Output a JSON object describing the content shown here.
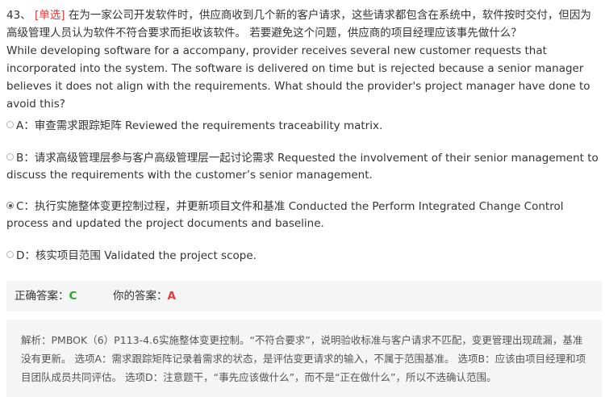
{
  "question": {
    "number": "43、",
    "tag": "[单选]",
    "text_cn": "在为一家公司开发软件时，供应商收到几个新的客户请求，这些请求都包含在系统中，软件按时交付，但因为高级管理人员认为软件不符合要求而拒收该软件。 若要避免这个问题，供应商的项目经理应该事先做什么？",
    "text_en": "While developing software for a accompany, provider receives several new customer requests that incorporated into the system. The software is delivered on time but is rejected because a senior manager believes it does not align with the requirements. What should the provider's project manager have done to avoid this?"
  },
  "options": [
    {
      "key": "A：",
      "text": "审查需求跟踪矩阵 Reviewed the requirements traceability matrix.",
      "selected": false
    },
    {
      "key": "B：",
      "text": "请求高级管理层参与客户高级管理层一起讨论需求 Requested the involvement of their senior management to discuss the requirements with the customer’s senior management.",
      "selected": false
    },
    {
      "key": "C：",
      "text": "执行实施整体变更控制过程，并更新项目文件和基准 Conducted the Perform Integrated Change Control process and updated the project documents and baseline.",
      "selected": true
    },
    {
      "key": "D：",
      "text": "核实项目范围 Validated the project scope.",
      "selected": false
    }
  ],
  "answer": {
    "correct_label": "正确答案：",
    "correct_value": "C",
    "yours_label": "你的答案：",
    "yours_value": "A"
  },
  "analysis": {
    "text": "解析：PMBOK（6）P113-4.6实施整体变更控制。“不符合要求”，说明验收标准与客户请求不匹配，变更管理出现疏漏，基准没有更新。 选项A：需求跟踪矩阵记录着需求的状态，是评估变更请求的输入，不属于范围基准。 选项B：应该由项目经理和项目团队成员共同评估。 选项D：注意题干，“事先应该做什么”，而不是“正在做什么”，所以不选确认范围。"
  },
  "colors": {
    "tag": "#e4393c",
    "correct": "#2aa52a",
    "wrong": "#e4393c",
    "panel_bg": "#f5f5f5"
  }
}
